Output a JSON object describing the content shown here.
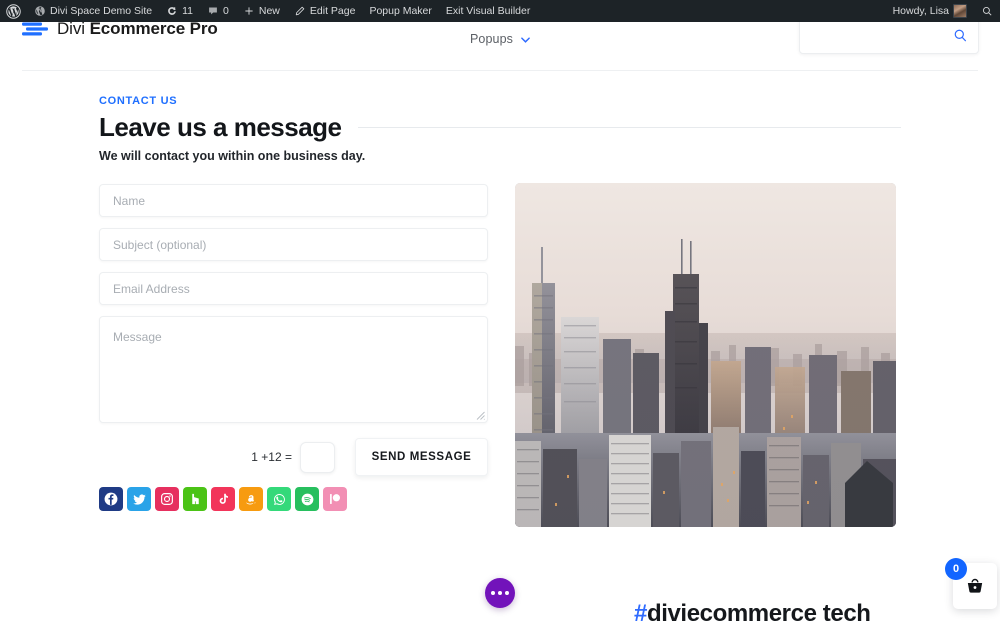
{
  "adminbar": {
    "wp_logo": "wordpress-logo-icon",
    "site_name": "Divi Space Demo Site",
    "updates_icon": "updates-icon",
    "updates_count": "11",
    "comments_icon": "comments-icon",
    "comments_count": "0",
    "new_icon": "plus-icon",
    "new_label": "New",
    "edit_icon": "pencil-icon",
    "edit_label": "Edit Page",
    "popup_maker_label": "Popup Maker",
    "exit_builder_label": "Exit Visual Builder",
    "howdy": "Howdy, Lisa",
    "avatar": "user-avatar",
    "search_icon": "search-icon"
  },
  "header": {
    "brand_light": "Divi ",
    "brand_bold": "Ecommerce Pro",
    "brand_mark": "divi-bars-logo-icon",
    "nav": [
      {
        "label": "Popups",
        "has_dropdown": true
      }
    ],
    "search": {
      "placeholder": "",
      "value": "",
      "icon": "search-icon"
    }
  },
  "contact": {
    "eyebrow": "CONTACT US",
    "title": "Leave us a message",
    "subtitle": "We will contact you within one business day.",
    "fields": [
      {
        "name": "name",
        "placeholder": "Name",
        "value": ""
      },
      {
        "name": "subject",
        "placeholder": "Subject (optional)",
        "value": ""
      },
      {
        "name": "email",
        "placeholder": "Email Address",
        "value": ""
      }
    ],
    "message": {
      "placeholder": "Message",
      "value": ""
    },
    "captcha": {
      "question": "1 +12 =",
      "value": ""
    },
    "submit_label": "SEND MESSAGE"
  },
  "socials": [
    {
      "name": "facebook",
      "color": "#1f3b85"
    },
    {
      "name": "twitter",
      "color": "#2aa3e8"
    },
    {
      "name": "instagram",
      "color": "#e6305f"
    },
    {
      "name": "houzz",
      "color": "#4bc316"
    },
    {
      "name": "tiktok",
      "color": "#f2355a"
    },
    {
      "name": "amazon",
      "color": "#f79b10"
    },
    {
      "name": "whatsapp",
      "color": "#34d97a"
    },
    {
      "name": "spotify",
      "color": "#27bf5e"
    },
    {
      "name": "patreon",
      "color": "#f28fb4"
    }
  ],
  "photo": {
    "alt": "city-skyline-aerial-photo"
  },
  "floating": {
    "dots_button": "more-options-button",
    "hashtag_symbol": "#",
    "hashtag_text": "diviecommerce tech",
    "cart_count": "0",
    "cart_icon": "shopping-basket-icon"
  },
  "colors": {
    "accent_blue": "#1f6fff",
    "admin_bar": "#1d2327",
    "purple": "#7213ba",
    "cart_badge": "#1265ff"
  }
}
